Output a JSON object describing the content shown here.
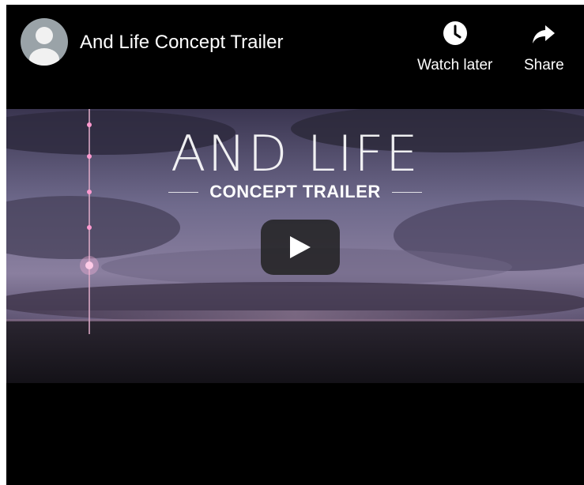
{
  "video": {
    "title": "And Life Concept Trailer",
    "thumbnail_headline": "AND LIFE",
    "thumbnail_subhead": "CONCEPT TRAILER"
  },
  "actions": {
    "watch_later_label": "Watch later",
    "share_label": "Share"
  },
  "icons": {
    "avatar": "person-avatar-icon",
    "watch_later": "clock-icon",
    "share": "share-arrow-icon",
    "play": "play-icon"
  },
  "colors": {
    "background": "#000000",
    "text": "#ffffff",
    "play_button": "#212121"
  }
}
